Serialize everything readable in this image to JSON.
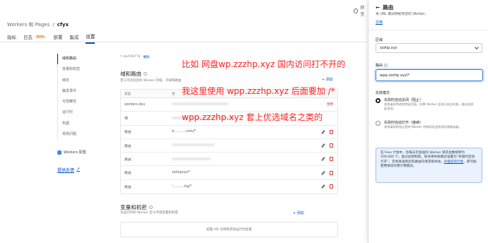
{
  "topbar": {
    "search_fragment": "转至"
  },
  "breadcrumb": {
    "parent": "Workers 和 Pages",
    "separator": "/",
    "current": "cfyx"
  },
  "tabs": [
    {
      "label": "指标"
    },
    {
      "label": "日志",
      "badge": "Beta"
    },
    {
      "label": "部署"
    },
    {
      "label": "集成"
    },
    {
      "label": "设置"
    }
  ],
  "sidenav": {
    "items": [
      "域和路由",
      "变量和机密",
      "绑定",
      "触发事件",
      "可观察性",
      "运行时",
      "构建",
      "常规问题"
    ],
    "workers_config": "Workers 配置",
    "feedback": "提供反馈"
  },
  "version": {
    "id": "Y ab4f48778",
    "link": "删除"
  },
  "domains": {
    "title": "域和路由",
    "subtitle": "定义可访问您的 Worker 的域、子域和路由",
    "add": "+ 添加",
    "columns": {
      "type": "类型",
      "value": "值"
    },
    "rows": [
      {
        "type": "workers.dev",
        "value": "",
        "status": "禁用",
        "actions": false
      },
      {
        "type": "预",
        "value": "",
        "status": "",
        "actions": false
      },
      {
        "type": "路由",
        "value": "b...........com/*",
        "status": "",
        "actions": true
      },
      {
        "type": "路由",
        "value": "",
        "status": "",
        "actions": true
      },
      {
        "type": "路由",
        "value": "",
        "status": "",
        "actions": true
      },
      {
        "type": "路由",
        "value": "zzzhpxyz/*",
        "status": "",
        "actions": true
      },
      {
        "type": "路由",
        "value": "'..........:kg/*",
        "status": "",
        "actions": true
      }
    ]
  },
  "variables": {
    "title": "变量和机密",
    "subtitle": "为运行时的 Worker 定义环境变量和机密",
    "add": "+ 添加",
    "empty": "配置 API 令牌和其他运行时变量"
  },
  "annotations": [
    "比如 网盘wp.zzzhp.xyz 国内访问打不开的",
    "我这里使用 wpp.zzzhp.xyz 后面要加 /*",
    "wpp.zzzhp.xyz 套上优选域名之类的"
  ],
  "panel": {
    "back": "←",
    "title": "路由",
    "description": "将 URL 模式映射到您的 Worker。",
    "docs": "文档",
    "zone_label": "区域",
    "zone_value": "zzzhp.xyz",
    "route_label": "路由",
    "route_value": "wpp.zzzhp.xyz/*",
    "failure_label": "失败模式",
    "options": [
      {
        "title": "失败时自动关闭（阻止）",
        "desc": "其他请求将收到错误页面。如果 Worker 会执行安全检查，建议选择此选项。",
        "selected": true
      },
      {
        "title": "失败时自动打开（继续）",
        "desc": "其他请求将绕过您的 Worker 并继续发送到您的源服务器。",
        "selected": false
      }
    ],
    "note_text": "在 Free 计划中，您每天可发送的 Worker 请求总数限制为 100,000 个。超过此限制后，除非将失败模式设置为“失败时自动打开”，否则发送到您的路由的请求将失败。",
    "note_link": "升级您的计划",
    "note_tail": "，即可按使用情况付费计费模式。"
  },
  "colors": {
    "accent": "#0051c3",
    "annotation": "#ff2020",
    "danger": "#d23b3b"
  }
}
